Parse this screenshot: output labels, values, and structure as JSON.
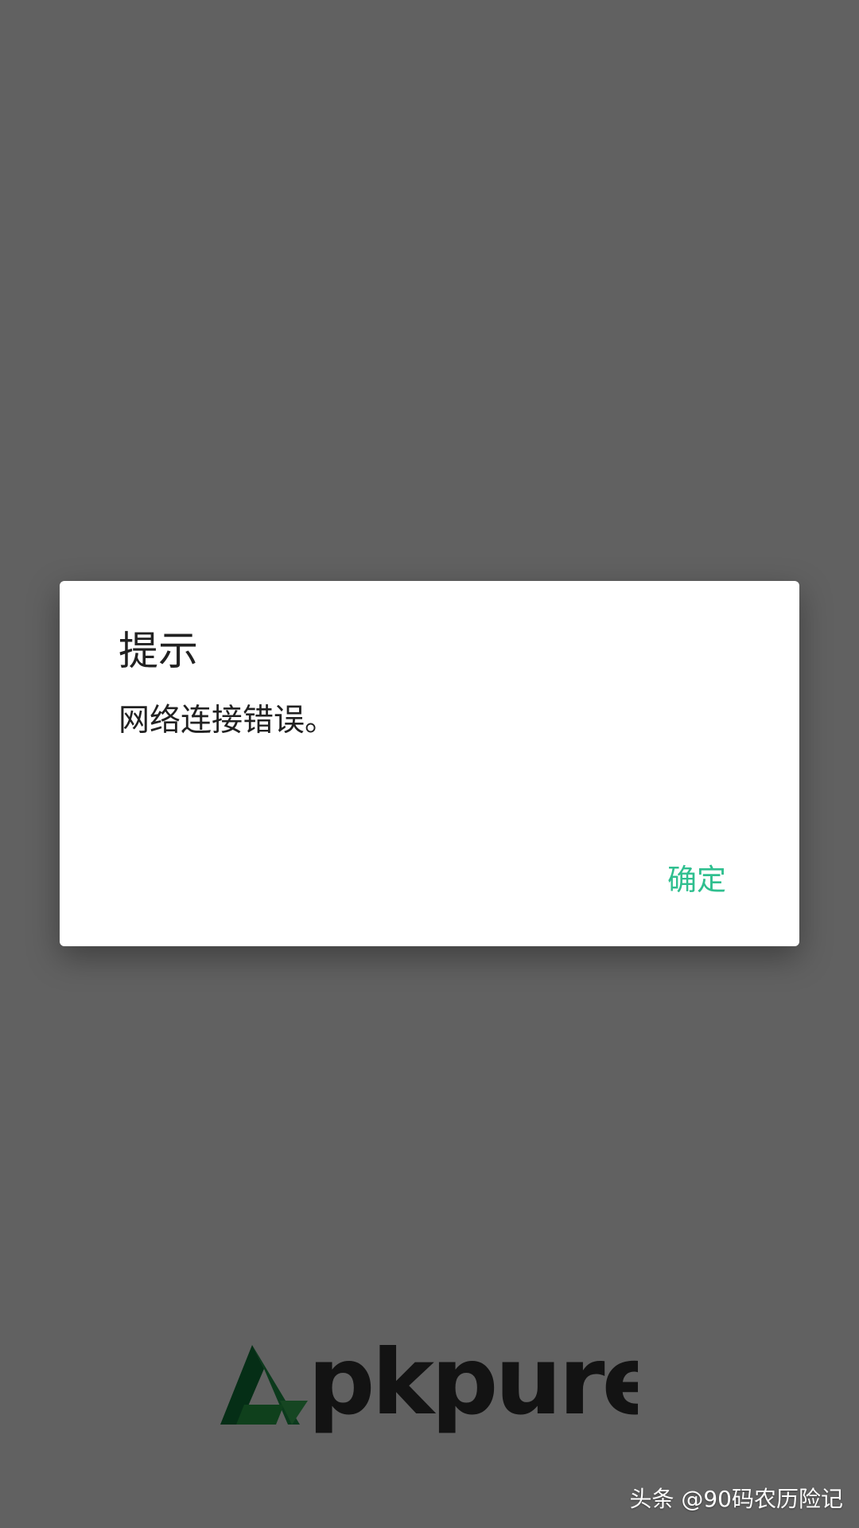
{
  "dialog": {
    "title": "提示",
    "message": "网络连接错误。",
    "confirm_label": "确定"
  },
  "logo": {
    "name": "Apkpure",
    "wordmark": "pkpure",
    "icon": "apkpure-triangle-logo-icon"
  },
  "watermark": {
    "text": "头条 @90码农历险记"
  },
  "colors": {
    "scrim": "#616161",
    "accent": "#2fbf8f",
    "logo_green_dark": "#0f7a3a",
    "logo_green_light": "#28a84a",
    "logo_text": "#333333"
  }
}
